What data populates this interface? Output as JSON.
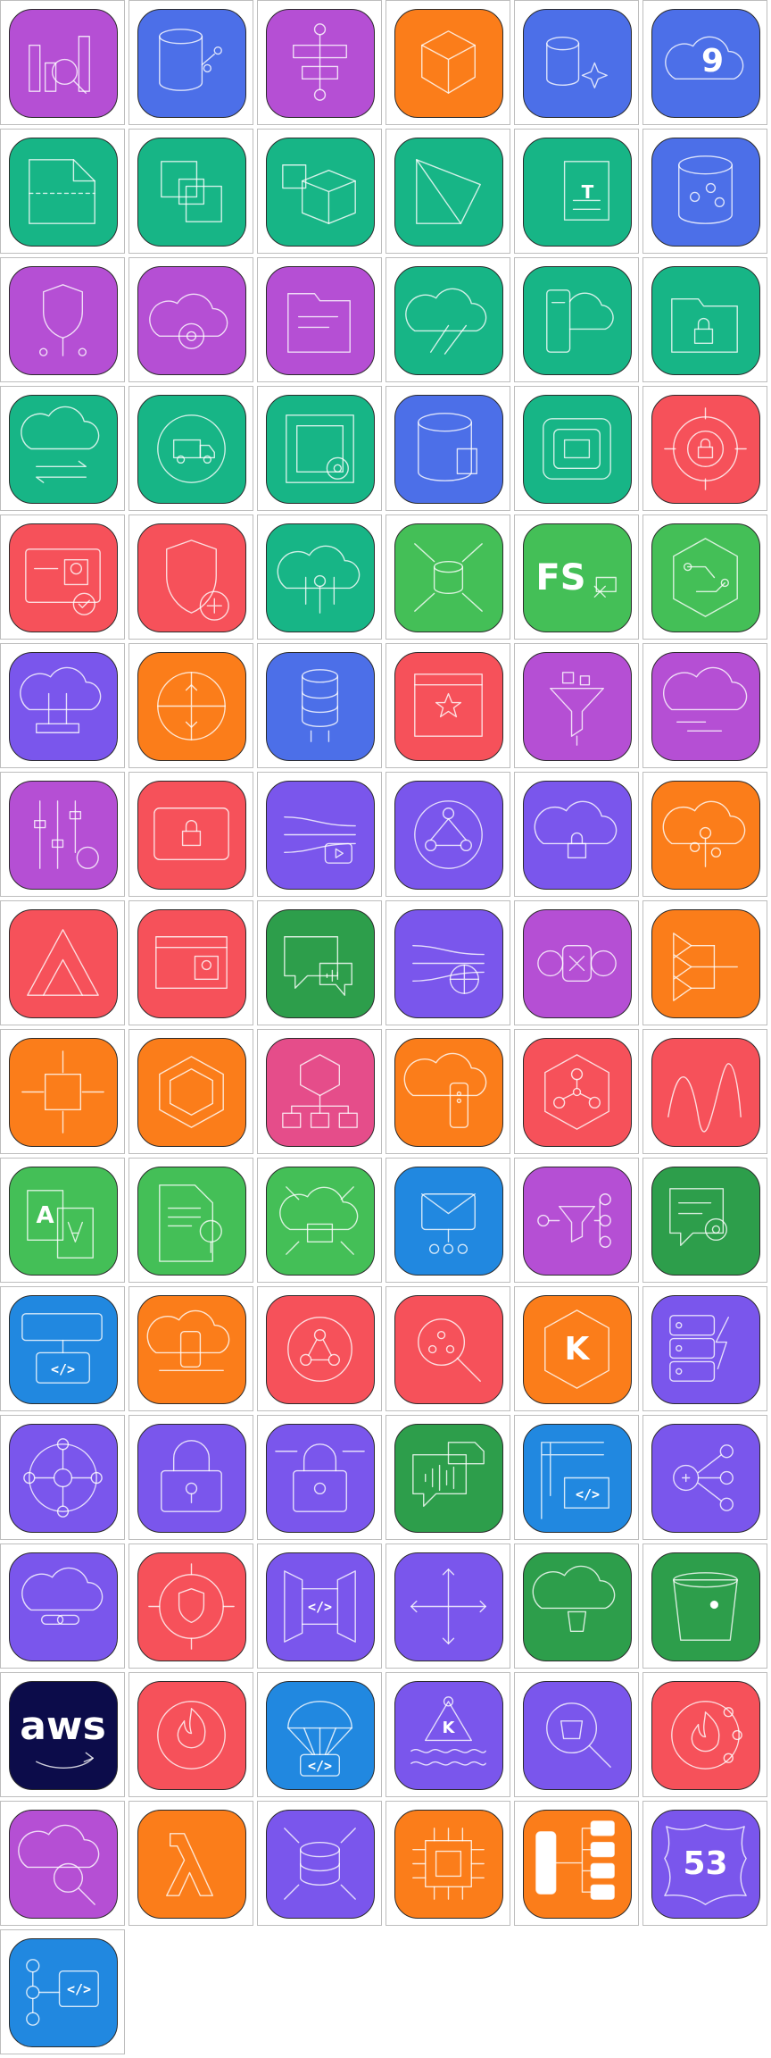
{
  "colors": {
    "purple": "#b54fd4",
    "blue": "#4c6fe8",
    "orange": "#fb7d1a",
    "teal": "#17b586",
    "red": "#f6515a",
    "green": "#44bf57",
    "violet": "#7a56ec",
    "darkgreen": "#2d9e4b",
    "pink": "#e54d8a",
    "skyblue": "#2188e0",
    "navy": "#0c0c4a"
  },
  "icons": [
    {
      "name": "analytics-magnifier-icon",
      "color": "purple"
    },
    {
      "name": "database-network-icon",
      "color": "blue"
    },
    {
      "name": "workflow-flowchart-icon",
      "color": "purple"
    },
    {
      "name": "cube-icon",
      "color": "orange"
    },
    {
      "name": "database-sparkle-icon",
      "color": "blue"
    },
    {
      "name": "cloud-nine-icon",
      "color": "blue",
      "text": "9"
    },
    {
      "name": "folded-document-icon",
      "color": "teal"
    },
    {
      "name": "connected-squares-icon",
      "color": "teal"
    },
    {
      "name": "boxes-icon",
      "color": "teal"
    },
    {
      "name": "prism-icon",
      "color": "teal"
    },
    {
      "name": "document-translate-icon",
      "color": "teal",
      "text": "T"
    },
    {
      "name": "bucket-graph-icon",
      "color": "blue"
    },
    {
      "name": "shield-network-icon",
      "color": "purple"
    },
    {
      "name": "cloud-gear-icon",
      "color": "purple"
    },
    {
      "name": "folder-list-icon",
      "color": "purple"
    },
    {
      "name": "cloud-arrows-icon",
      "color": "teal"
    },
    {
      "name": "server-cloud-icon",
      "color": "teal"
    },
    {
      "name": "folder-lock-icon",
      "color": "teal"
    },
    {
      "name": "cloud-sync-icon",
      "color": "teal"
    },
    {
      "name": "truck-icon",
      "color": "teal"
    },
    {
      "name": "maze-gear-icon",
      "color": "teal"
    },
    {
      "name": "database-document-icon",
      "color": "blue"
    },
    {
      "name": "device-frame-icon",
      "color": "teal"
    },
    {
      "name": "target-lock-icon",
      "color": "red"
    },
    {
      "name": "id-card-check-icon",
      "color": "red"
    },
    {
      "name": "shield-plus-icon",
      "color": "red"
    },
    {
      "name": "cloud-tree-icon",
      "color": "teal"
    },
    {
      "name": "database-arrows-icon",
      "color": "green"
    },
    {
      "name": "fsx-icon",
      "color": "green",
      "text": "FS"
    },
    {
      "name": "hexagon-circuit-icon",
      "color": "green"
    },
    {
      "name": "cloud-sliders-icon",
      "color": "violet"
    },
    {
      "name": "circle-arrows-icon",
      "color": "orange"
    },
    {
      "name": "database-stack-icon",
      "color": "blue"
    },
    {
      "name": "browser-star-icon",
      "color": "red"
    },
    {
      "name": "funnel-icon",
      "color": "purple"
    },
    {
      "name": "cloud-speed-icon",
      "color": "purple"
    },
    {
      "name": "sliders-gear-icon",
      "color": "purple"
    },
    {
      "name": "card-lock-icon",
      "color": "red"
    },
    {
      "name": "video-stream-icon",
      "color": "violet"
    },
    {
      "name": "globe-network-icon",
      "color": "violet"
    },
    {
      "name": "cloud-lock-icon",
      "color": "violet"
    },
    {
      "name": "cloud-tree-orange-icon",
      "color": "orange"
    },
    {
      "name": "triangles-icon",
      "color": "red"
    },
    {
      "name": "card-user-icon",
      "color": "red"
    },
    {
      "name": "chat-audio-icon",
      "color": "darkgreen"
    },
    {
      "name": "globe-stream-icon",
      "color": "violet"
    },
    {
      "name": "circle-link-icon",
      "color": "purple"
    },
    {
      "name": "triangle-flow-icon",
      "color": "orange"
    },
    {
      "name": "chip-arrows-icon",
      "color": "orange"
    },
    {
      "name": "hexagon-icon",
      "color": "orange"
    },
    {
      "name": "cube-hierarchy-icon",
      "color": "pink"
    },
    {
      "name": "cloud-server-icon",
      "color": "orange"
    },
    {
      "name": "cube-network-icon",
      "color": "red"
    },
    {
      "name": "wave-icon",
      "color": "red"
    },
    {
      "name": "document-translate-a-icon",
      "color": "green",
      "text": "A"
    },
    {
      "name": "document-bulb-icon",
      "color": "green"
    },
    {
      "name": "cloud-folder-arrows-icon",
      "color": "green"
    },
    {
      "name": "envelope-network-icon",
      "color": "skyblue"
    },
    {
      "name": "filter-network-icon",
      "color": "purple"
    },
    {
      "name": "chat-gear-icon",
      "color": "darkgreen"
    },
    {
      "name": "browser-code-icon",
      "color": "skyblue",
      "text": "</>"
    },
    {
      "name": "cloud-device-icon",
      "color": "orange"
    },
    {
      "name": "circle-nodes-icon",
      "color": "red"
    },
    {
      "name": "magnifier-nodes-icon",
      "color": "red"
    },
    {
      "name": "hexagon-k-icon",
      "color": "orange",
      "text": "K"
    },
    {
      "name": "server-bolt-icon",
      "color": "violet"
    },
    {
      "name": "circle-cross-nodes-icon",
      "color": "violet"
    },
    {
      "name": "padlock-icon",
      "color": "violet"
    },
    {
      "name": "padlock-arrows-icon",
      "color": "violet"
    },
    {
      "name": "chat-audio-document-icon",
      "color": "darkgreen"
    },
    {
      "name": "crane-code-icon",
      "color": "skyblue",
      "text": "</>"
    },
    {
      "name": "plus-network-icon",
      "color": "violet"
    },
    {
      "name": "cloud-link-icon",
      "color": "violet"
    },
    {
      "name": "gear-shield-icon",
      "color": "red"
    },
    {
      "name": "panels-code-icon",
      "color": "violet",
      "text": "</>"
    },
    {
      "name": "crosshair-arrows-icon",
      "color": "violet"
    },
    {
      "name": "cloud-bucket-icon",
      "color": "darkgreen"
    },
    {
      "name": "bucket-icon",
      "color": "darkgreen"
    },
    {
      "name": "aws-logo-icon",
      "color": "navy",
      "text": "aws"
    },
    {
      "name": "flame-circle-icon",
      "color": "red"
    },
    {
      "name": "parachute-code-icon",
      "color": "skyblue",
      "text": "</>"
    },
    {
      "name": "triangle-k-waves-icon",
      "color": "violet",
      "text": "K"
    },
    {
      "name": "magnifier-bucket-icon",
      "color": "violet"
    },
    {
      "name": "flame-nodes-icon",
      "color": "red"
    },
    {
      "name": "cloud-magnifier-icon",
      "color": "purple"
    },
    {
      "name": "lambda-icon",
      "color": "orange"
    },
    {
      "name": "database-arrows-violet-icon",
      "color": "violet"
    },
    {
      "name": "chip-icon",
      "color": "orange"
    },
    {
      "name": "queue-bars-icon",
      "color": "orange"
    },
    {
      "name": "route53-shield-icon",
      "color": "violet",
      "text": "53"
    },
    {
      "name": "step-code-icon",
      "color": "skyblue",
      "text": "</>"
    }
  ]
}
